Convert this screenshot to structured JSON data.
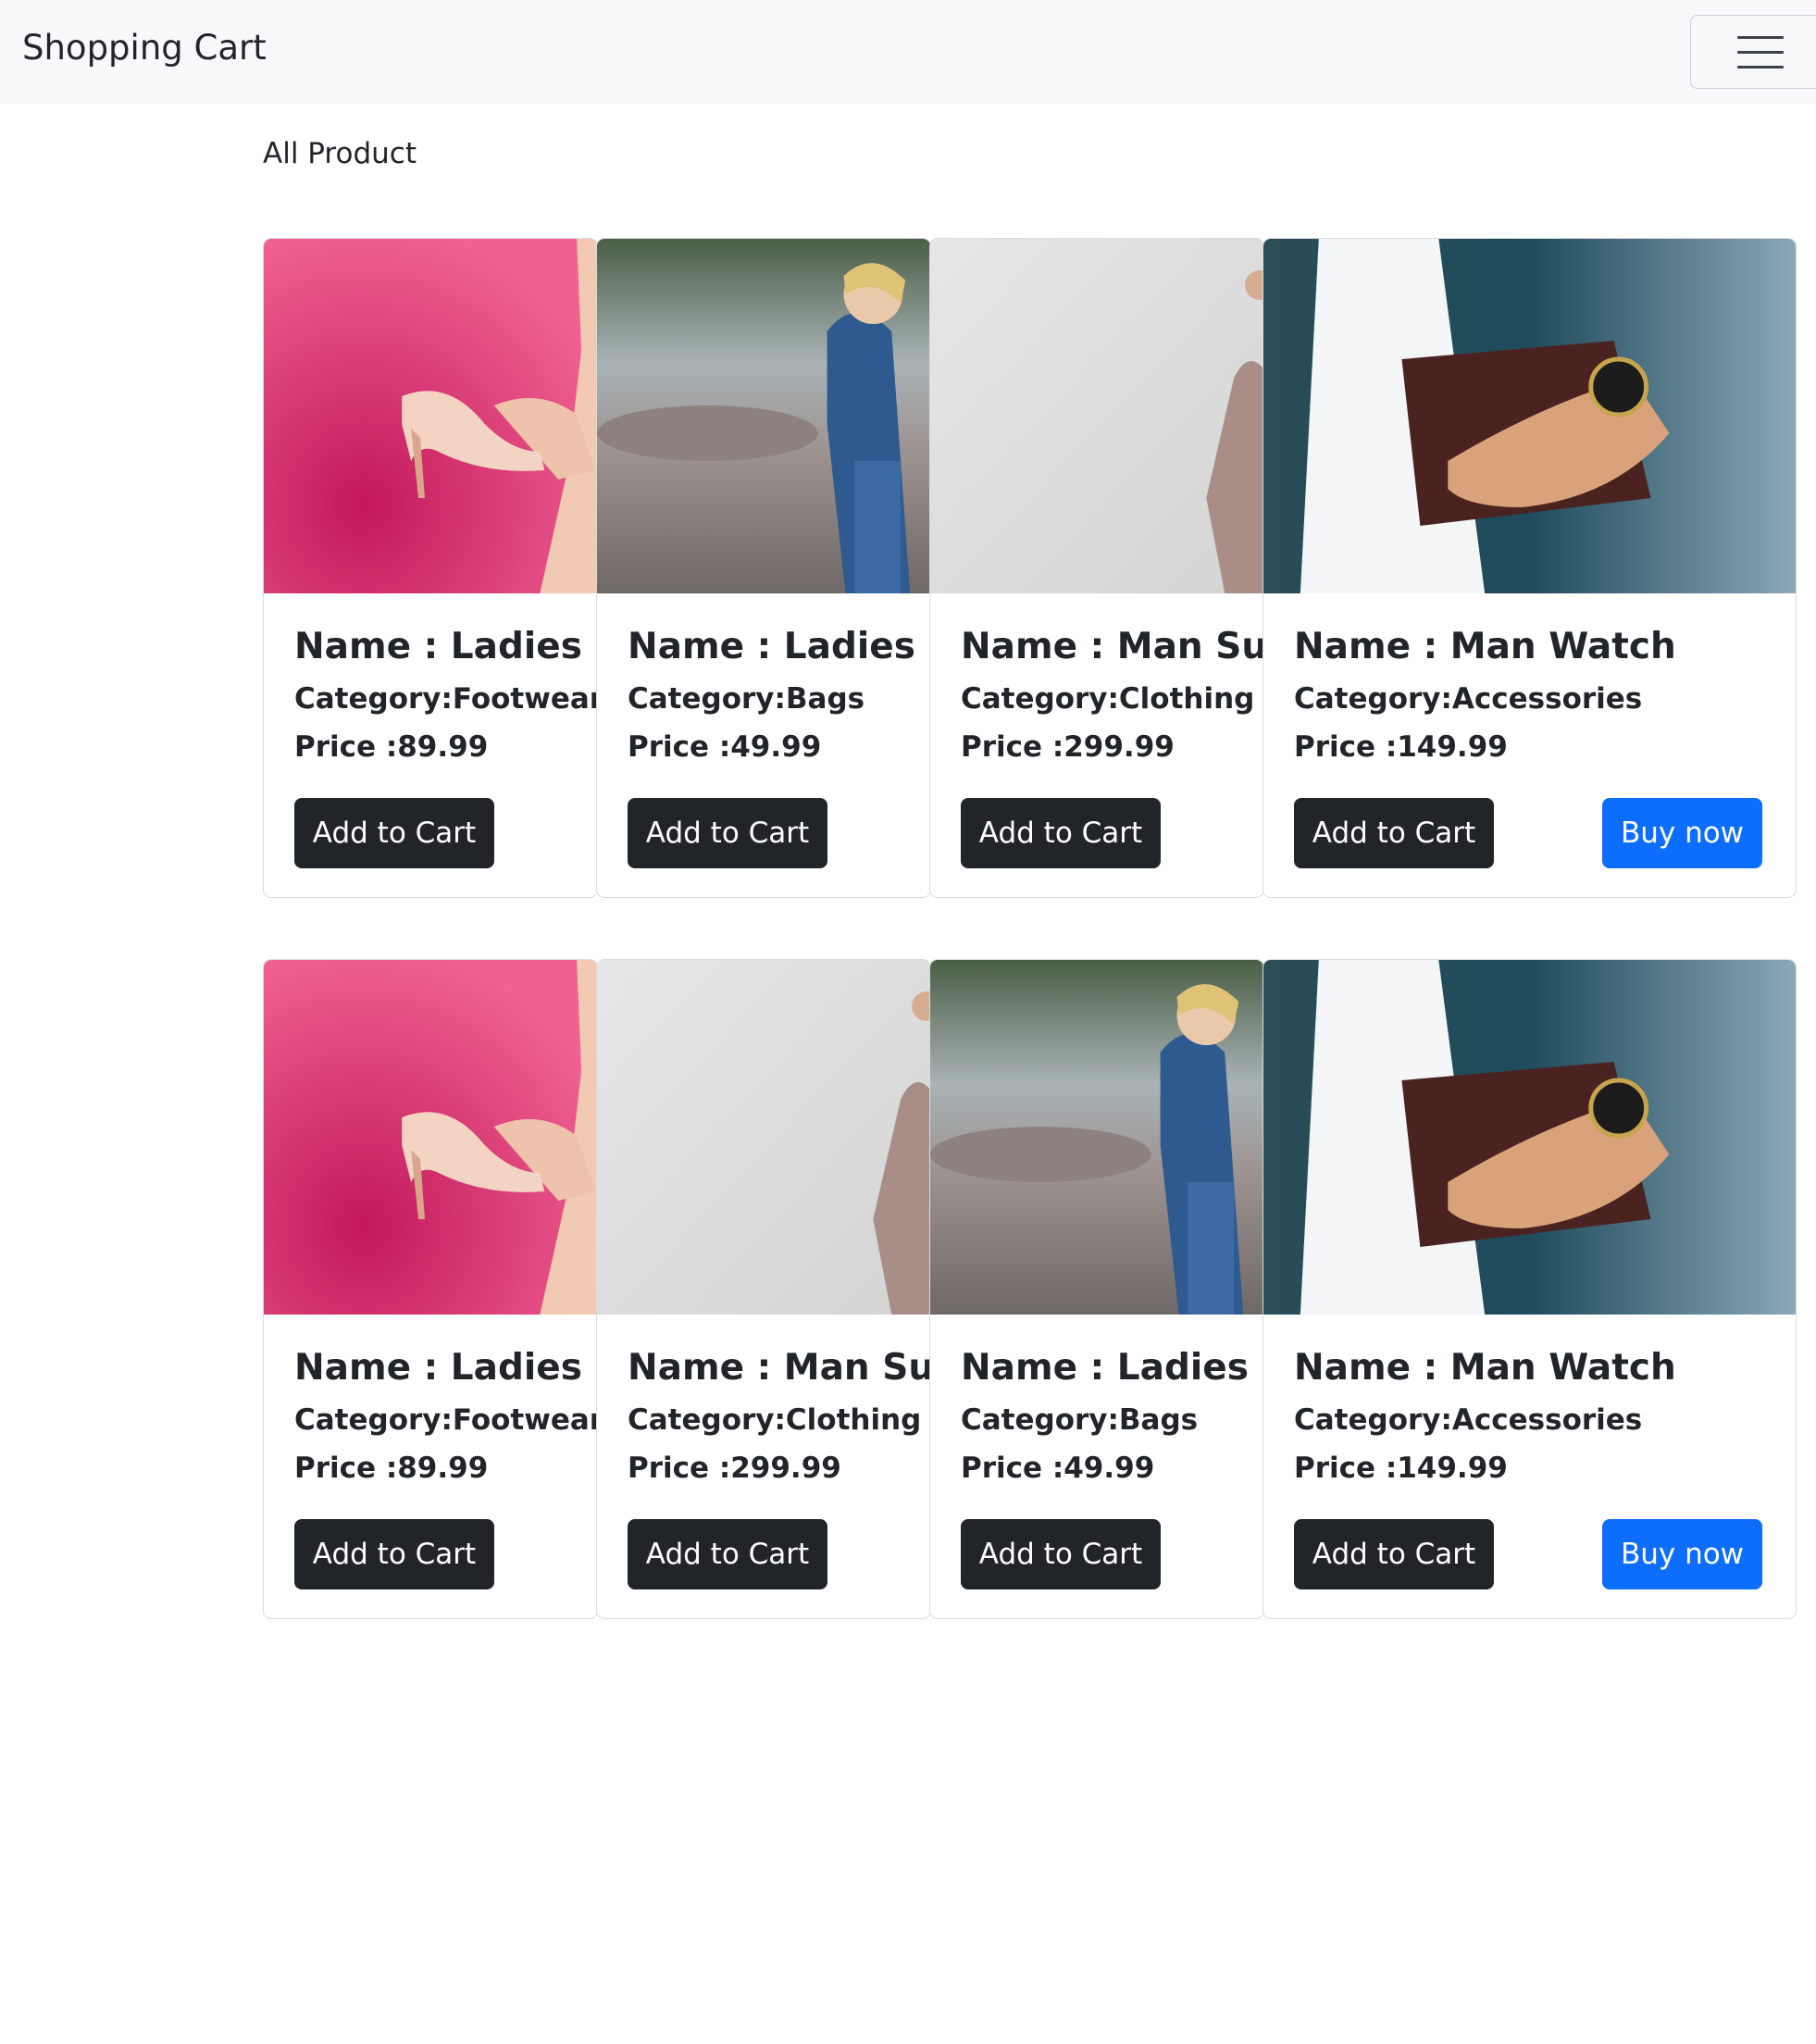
{
  "navbar": {
    "brand": "Shopping Cart",
    "menu_icon": "hamburger-menu-icon"
  },
  "section_title": "All Product",
  "rows": [
    {
      "cards": [
        {
          "name": "Name : Ladies Sho",
          "category": "Category:Footwear",
          "price": "Price :89.99",
          "cart_label": "Add to Cart",
          "image": "shoe-photo"
        },
        {
          "name": "Name : Ladies Bag",
          "category": "Category:Bags",
          "price": "Price :49.99",
          "cart_label": "Add to Cart",
          "image": "bag-photo"
        },
        {
          "name": "Name : Man Suit",
          "category": "Category:Clothing",
          "price": "Price :299.99",
          "cart_label": "Add to Cart",
          "image": "suit-photo"
        },
        {
          "name": "Name : Man Watch",
          "category": "Category:Accessories",
          "price": "Price :149.99",
          "cart_label": "Add to Cart",
          "buy_label": "Buy now",
          "image": "watch-photo"
        }
      ]
    },
    {
      "cards": [
        {
          "name": "Name : Ladies Sho",
          "category": "Category:Footwear",
          "price": "Price :89.99",
          "cart_label": "Add to Cart",
          "image": "shoe-photo"
        },
        {
          "name": "Name : Man Sui",
          "category": "Category:Clothing",
          "price": "Price :299.99",
          "cart_label": "Add to Cart",
          "image": "suit-photo"
        },
        {
          "name": "Name : Ladies Bag",
          "category": "Category:Bags",
          "price": "Price :49.99",
          "cart_label": "Add to Cart",
          "image": "bag-photo"
        },
        {
          "name": "Name : Man Watch",
          "category": "Category:Accessories",
          "price": "Price :149.99",
          "cart_label": "Add to Cart",
          "buy_label": "Buy now",
          "image": "watch-photo"
        }
      ]
    }
  ],
  "colors": {
    "navbar_bg": "#f8f9fa",
    "cart_button": "#212529",
    "buy_button": "#0d6efd",
    "card_border": "#d9dcdf"
  }
}
